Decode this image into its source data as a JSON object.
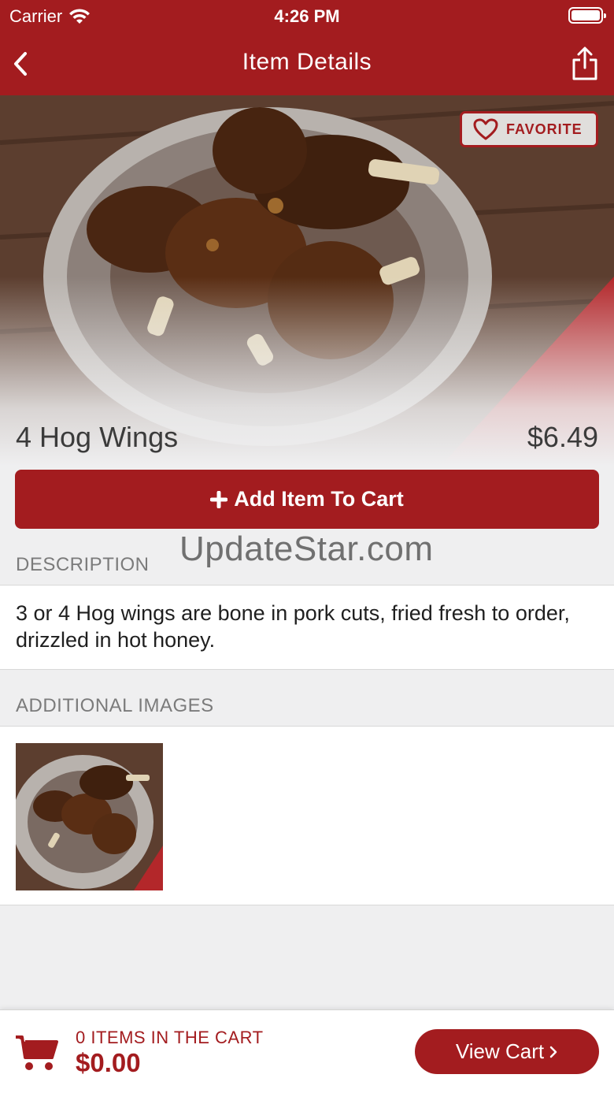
{
  "status_bar": {
    "carrier": "Carrier",
    "time": "4:26 PM"
  },
  "nav": {
    "title": "Item Details",
    "back_icon": "chevron-left-icon",
    "share_icon": "share-icon"
  },
  "hero": {
    "favorite_label": "FAVORITE",
    "favorite_icon": "heart-icon"
  },
  "item": {
    "name": "4 Hog Wings",
    "price": "$6.49"
  },
  "add_to_cart": {
    "label": "Add Item To Cart",
    "icon": "plus-icon"
  },
  "watermark": "UpdateStar.com",
  "description": {
    "header": "DESCRIPTION",
    "text": "3 or 4 Hog wings are bone in pork cuts, fried fresh to order, drizzled in hot honey."
  },
  "additional_images": {
    "header": "ADDITIONAL IMAGES",
    "count": 1
  },
  "cart": {
    "items_label": "0 ITEMS IN THE CART",
    "total": "$0.00",
    "view_cart_label": "View Cart",
    "cart_icon": "cart-icon"
  },
  "colors": {
    "brand": "#a31c1f",
    "background": "#efeff0",
    "text": "#3b3b3b"
  }
}
